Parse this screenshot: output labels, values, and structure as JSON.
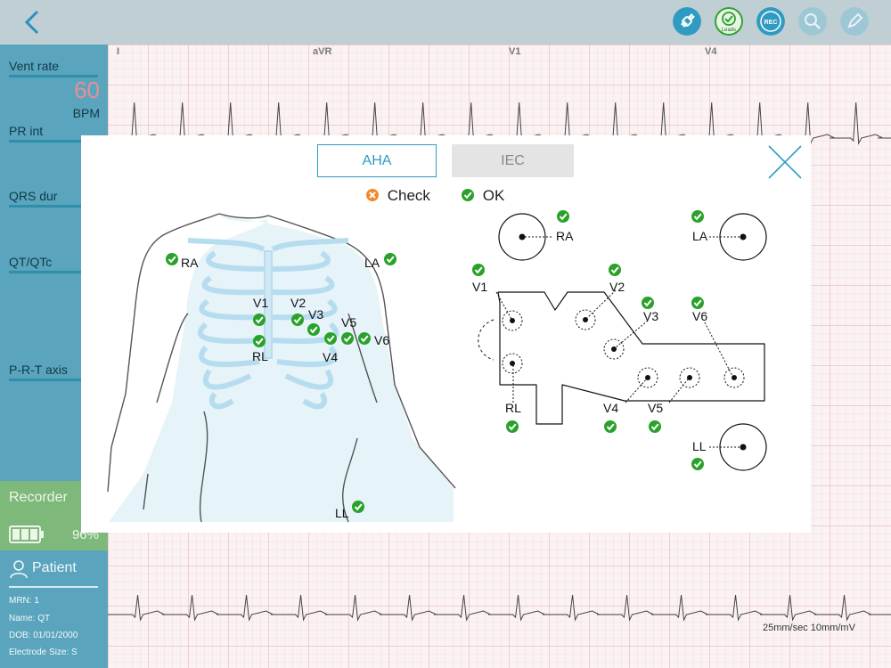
{
  "topbar": {
    "back_icon": "chevron-left-icon",
    "icons": [
      {
        "name": "disconnect-icon",
        "label": ""
      },
      {
        "name": "leads-icon",
        "label": "Leads"
      },
      {
        "name": "record-icon",
        "label": "REC"
      },
      {
        "name": "zoom-icon",
        "label": ""
      },
      {
        "name": "edit-icon",
        "label": ""
      }
    ]
  },
  "sidebar": {
    "vent_rate_label": "Vent rate",
    "vent_rate_value": "60",
    "vent_rate_unit": "BPM",
    "pr_label": "PR int",
    "qrs_label": "QRS dur",
    "qt_label": "QT/QTc",
    "axis_label": "P-R-T axis",
    "recorder_label": "Recorder",
    "battery": "96%",
    "patient_label": "Patient",
    "mrn": "MRN: 1",
    "name": "Name: QT",
    "dob": "DOB: 01/01/2000",
    "electrode_size": "Electrode Size: S"
  },
  "ecg": {
    "leads": [
      "I",
      "aVR",
      "V1",
      "V4"
    ],
    "speed": "25mm/sec  10mm/mV"
  },
  "modal": {
    "tab_aha": "AHA",
    "tab_iec": "IEC",
    "legend_check": "Check",
    "legend_ok": "OK",
    "body_labels": {
      "ra": "RA",
      "la": "LA",
      "v1": "V1",
      "v2": "V2",
      "v3": "V3",
      "v4": "V4",
      "v5": "V5",
      "v6": "V6",
      "rl": "RL",
      "ll": "LL"
    },
    "pad_labels": {
      "ra": "RA",
      "la": "LA",
      "v1": "V1",
      "v2": "V2",
      "v3": "V3",
      "v4": "V4",
      "v5": "V5",
      "v6": "V6",
      "rl": "RL",
      "ll": "LL"
    }
  },
  "colors": {
    "ok_green": "#2aa22a",
    "check_orange": "#ef8a2c",
    "accent_blue": "#2e9cc3",
    "sidebar_blue": "#5aa5bd",
    "recorder_green": "#7fb87b",
    "ecg_grid": "#e9b7b7"
  }
}
